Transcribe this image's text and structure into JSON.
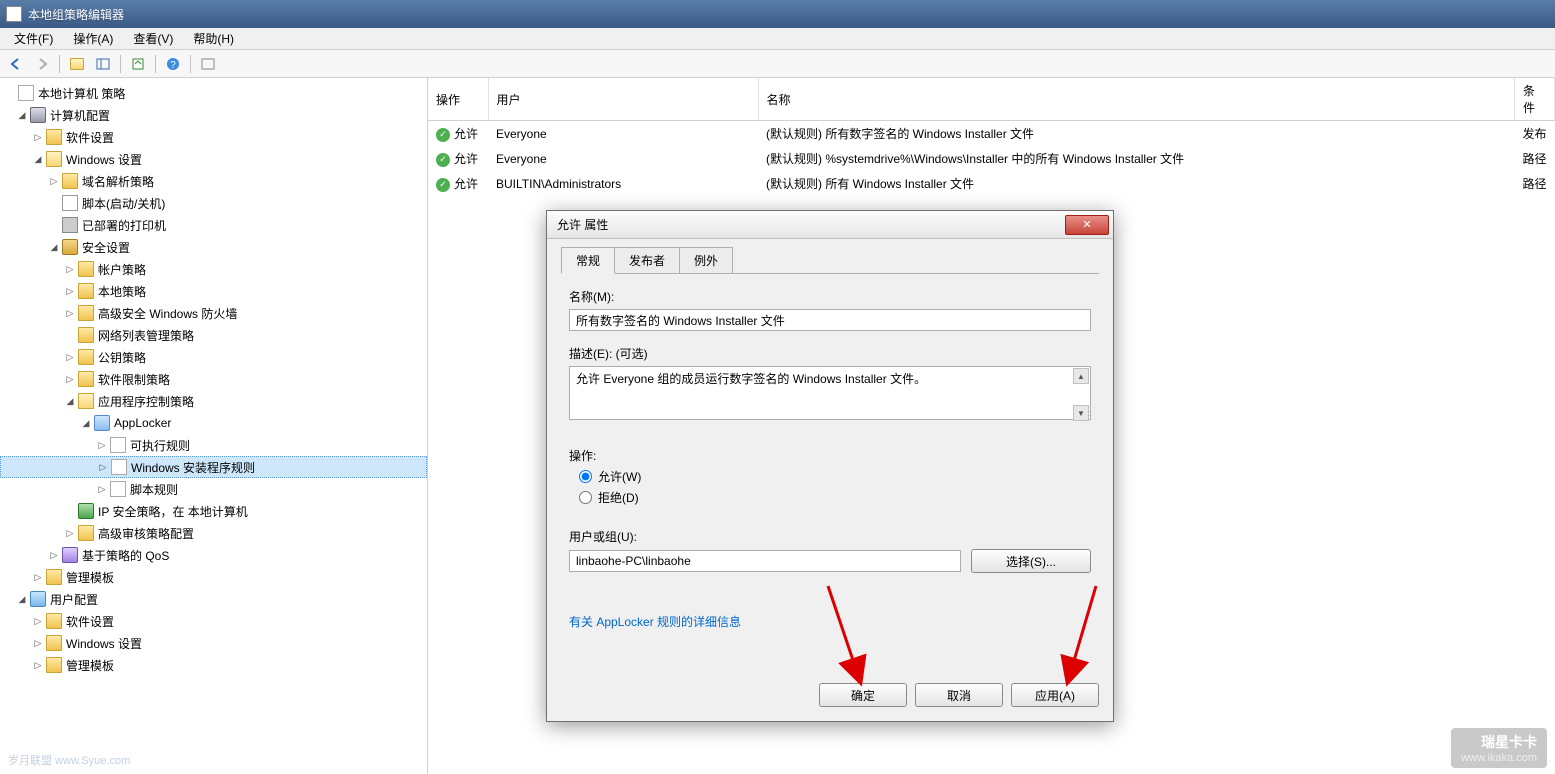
{
  "window": {
    "title": "本地组策略编辑器"
  },
  "menubar": {
    "file": "文件(F)",
    "action": "操作(A)",
    "view": "查看(V)",
    "help": "帮助(H)"
  },
  "tree": {
    "root": "本地计算机 策略",
    "computer_config": "计算机配置",
    "software_settings": "软件设置",
    "windows_settings": "Windows 设置",
    "name_resolution": "域名解析策略",
    "scripts": "脚本(启动/关机)",
    "deployed_printers": "已部署的打印机",
    "security_settings": "安全设置",
    "account_policies": "帐户策略",
    "local_policies": "本地策略",
    "advanced_firewall": "高级安全 Windows 防火墙",
    "network_list": "网络列表管理策略",
    "public_key": "公钥策略",
    "software_restriction": "软件限制策略",
    "app_control": "应用程序控制策略",
    "applocker": "AppLocker",
    "executable_rules": "可执行规则",
    "installer_rules": "Windows 安装程序规则",
    "script_rules": "脚本规则",
    "ip_security": "IP 安全策略，在 本地计算机",
    "advanced_audit": "高级审核策略配置",
    "policy_qos": "基于策略的 QoS",
    "admin_templates": "管理模板",
    "user_config": "用户配置",
    "user_software": "软件设置",
    "user_windows": "Windows 设置",
    "user_admin_templates": "管理模板"
  },
  "list": {
    "headers": {
      "action": "操作",
      "user": "用户",
      "name": "名称",
      "condition": "条件"
    },
    "rows": [
      {
        "action": "允许",
        "user": "Everyone",
        "name": "(默认规则) 所有数字签名的 Windows Installer 文件",
        "condition": "发布"
      },
      {
        "action": "允许",
        "user": "Everyone",
        "name": "(默认规则) %systemdrive%\\Windows\\Installer 中的所有 Windows Installer 文件",
        "condition": "路径"
      },
      {
        "action": "允许",
        "user": "BUILTIN\\Administrators",
        "name": "(默认规则) 所有 Windows Installer 文件",
        "condition": "路径"
      }
    ]
  },
  "dialog": {
    "title": "允许 属性",
    "tabs": {
      "general": "常规",
      "publisher": "发布者",
      "exceptions": "例外"
    },
    "name_label": "名称(M):",
    "name_value": "所有数字签名的 Windows Installer 文件",
    "desc_label": "描述(E): (可选)",
    "desc_value": "允许 Everyone 组的成员运行数字签名的 Windows Installer 文件。",
    "action_label": "操作:",
    "allow": "允许(W)",
    "deny": "拒绝(D)",
    "user_label": "用户或组(U):",
    "user_value": "linbaohe-PC\\linbaohe",
    "select_btn": "选择(S)...",
    "more_info": "有关 AppLocker 规则的详细信息",
    "ok": "确定",
    "cancel": "取消",
    "apply": "应用(A)"
  },
  "watermark": {
    "left": "岁月联盟  www.Syue.com",
    "right_top": "瑞星卡卡",
    "right_bottom": "www.ikaka.com"
  }
}
